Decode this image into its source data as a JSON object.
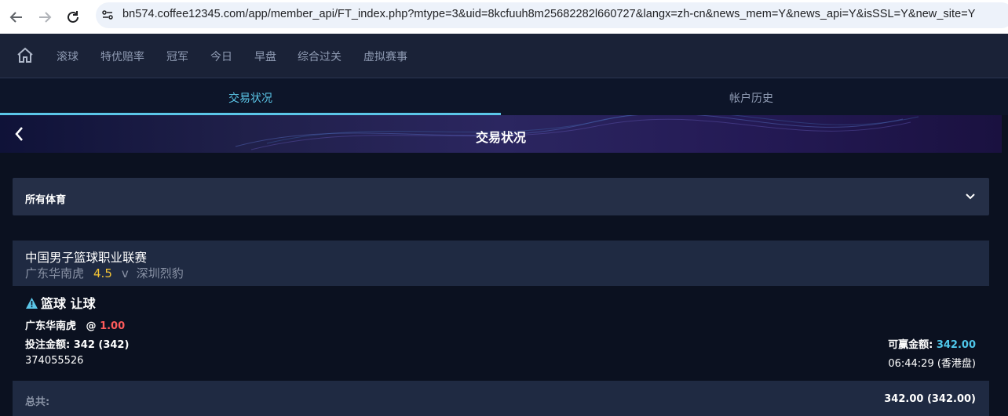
{
  "browser": {
    "url": "bn574.coffee12345.com/app/member_api/FT_index.php?mtype=3&uid=8kcfuuh8m25682282l660727&langx=zh-cn&news_mem=Y&news_api=Y&isSSL=Y&new_site=Y"
  },
  "topnav": {
    "items": [
      "滚球",
      "特优赔率",
      "冠军",
      "今日",
      "早盘",
      "综合过关",
      "虚拟赛事"
    ]
  },
  "tabs": [
    "交易状况",
    "帐户历史"
  ],
  "banner": {
    "title": "交易状况"
  },
  "filter": {
    "label": "所有体育"
  },
  "bet": {
    "league": "中国男子篮球职业联赛",
    "home_team": "广东华南虎",
    "handicap": "4.5",
    "vs": "v",
    "away_team": "深圳烈豹",
    "title": "篮球 让球",
    "selection": "广东华南虎",
    "odds_prefix": "@",
    "odds": "1.00",
    "stake_label": "投注金额:",
    "stake_value": "342 (342)",
    "ticket_id": "374055526",
    "win_label": "可赢金额:",
    "win_value": "342.00",
    "time": "06:44:29 (香港盘)"
  },
  "total": {
    "label": "总共:",
    "value": "342.00 (342.00)"
  },
  "colors": {
    "accent": "#5bc6e8",
    "handicap": "#f2c335",
    "odds": "#ff5b5b",
    "win": "#4fc7ea"
  }
}
